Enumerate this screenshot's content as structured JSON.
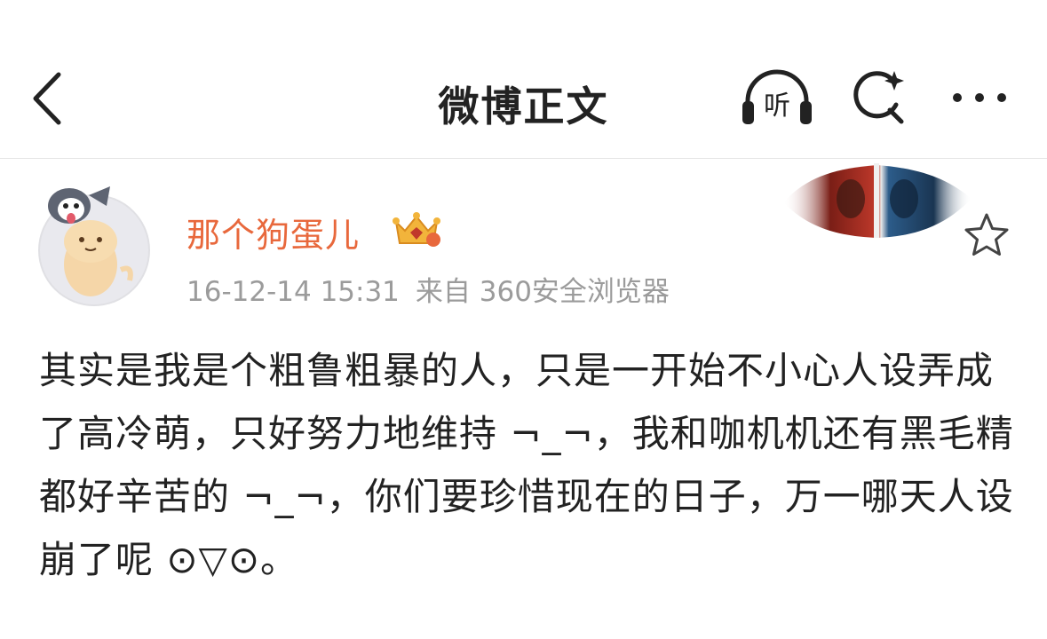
{
  "header": {
    "title": "微博正文",
    "listen_label": "听",
    "icons": {
      "back": "chevron-left-icon",
      "listen": "headphones-icon",
      "search": "search-sparkle-icon",
      "more": "more-dots-icon"
    }
  },
  "post": {
    "author": "那个狗蛋儿",
    "timestamp": "16-12-14 15:31",
    "source": "来自 360安全浏览器",
    "content": "其实是我是个粗鲁粗暴的人，只是一开始不小心人设弄成了高冷萌，只好努力地维持 ¬_¬，我和咖机机还有黑毛精都好辛苦的 ¬_¬，你们要珍惜现在的日子，万一哪天人设崩了呢 ⊙▽⊙。",
    "badge_icon": "vip-crown-icon",
    "favorite_icon": "star-outline-icon"
  },
  "colors": {
    "username": "#e8683c",
    "meta": "#9b9b9b",
    "text": "#222222",
    "divider": "#e6e6e6"
  }
}
